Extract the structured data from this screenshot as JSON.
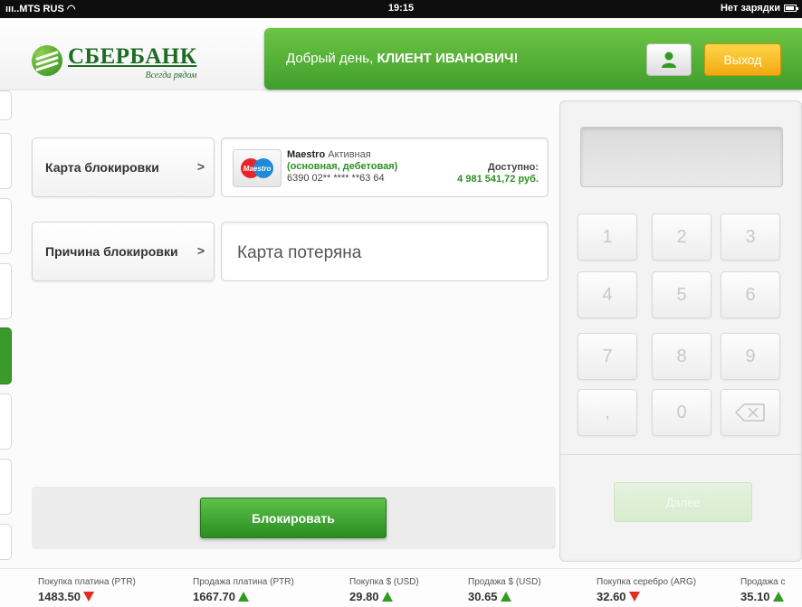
{
  "status_bar": {
    "carrier": "MTS RUS",
    "time": "19:15",
    "battery_text": "Нет зарядки"
  },
  "header": {
    "bank_name": "СБЕРБАНК",
    "tagline": "Всегда рядом",
    "greeting_prefix": "Добрый день,",
    "client_name": "КЛИЕНТ ИВАНОВИЧ!",
    "exit_label": "Выход",
    "user_icon": "user-icon",
    "brand_color": "#3f9e2b"
  },
  "form": {
    "card_row_label": "Карта блокировки",
    "card": {
      "brand": "Maestro",
      "logo_text": "Maestro",
      "status": "Активная",
      "type": "(основная, дебетовая)",
      "number": "6390 02** **** **63 64",
      "available_label": "Доступно:",
      "available_amount": "4 981 541,72 руб."
    },
    "reason_row_label": "Причина блокировки",
    "reason_value": "Карта потеряна",
    "submit_label": "Блокировать"
  },
  "keypad": {
    "keys": [
      "1",
      "2",
      "3",
      "4",
      "5",
      "6",
      "7",
      "8",
      "9",
      ",",
      "0"
    ],
    "backspace_icon": "backspace-icon",
    "next_label": "Далее"
  },
  "ticker": [
    {
      "name": "Покупка платина (PTR)",
      "value": "1483.50",
      "trend": "down"
    },
    {
      "name": "Продажа платина (PTR)",
      "value": "1667.70",
      "trend": "up"
    },
    {
      "name": "Покупка $ (USD)",
      "value": "29.80",
      "trend": "up"
    },
    {
      "name": "Продажа $ (USD)",
      "value": "30.65",
      "trend": "up"
    },
    {
      "name": "Покупка серебро (ARG)",
      "value": "32.60",
      "trend": "down"
    },
    {
      "name": "Продажа с",
      "value": "35.10",
      "trend": "up"
    }
  ]
}
